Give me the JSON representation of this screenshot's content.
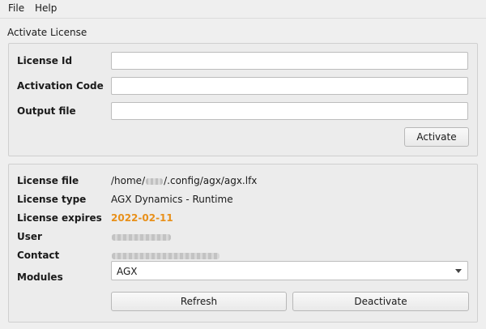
{
  "menu": {
    "file": "File",
    "help": "Help"
  },
  "activate": {
    "section_title": "Activate License",
    "license_id_label": "License Id",
    "license_id_value": "",
    "activation_code_label": "Activation Code",
    "activation_code_value": "",
    "output_file_label": "Output file",
    "output_file_value": "",
    "activate_button": "Activate"
  },
  "info": {
    "license_file_label": "License file",
    "license_file_prefix": "/home/",
    "license_file_suffix": "/.config/agx/agx.lfx",
    "license_type_label": "License type",
    "license_type_value": "AGX Dynamics - Runtime",
    "license_expires_label": "License expires",
    "license_expires_value": "2022-02-11",
    "user_label": "User",
    "contact_label": "Contact",
    "modules_label": "Modules",
    "modules_selected": "AGX",
    "refresh_button": "Refresh",
    "deactivate_button": "Deactivate"
  },
  "colors": {
    "expires_accent": "#e8901a"
  }
}
